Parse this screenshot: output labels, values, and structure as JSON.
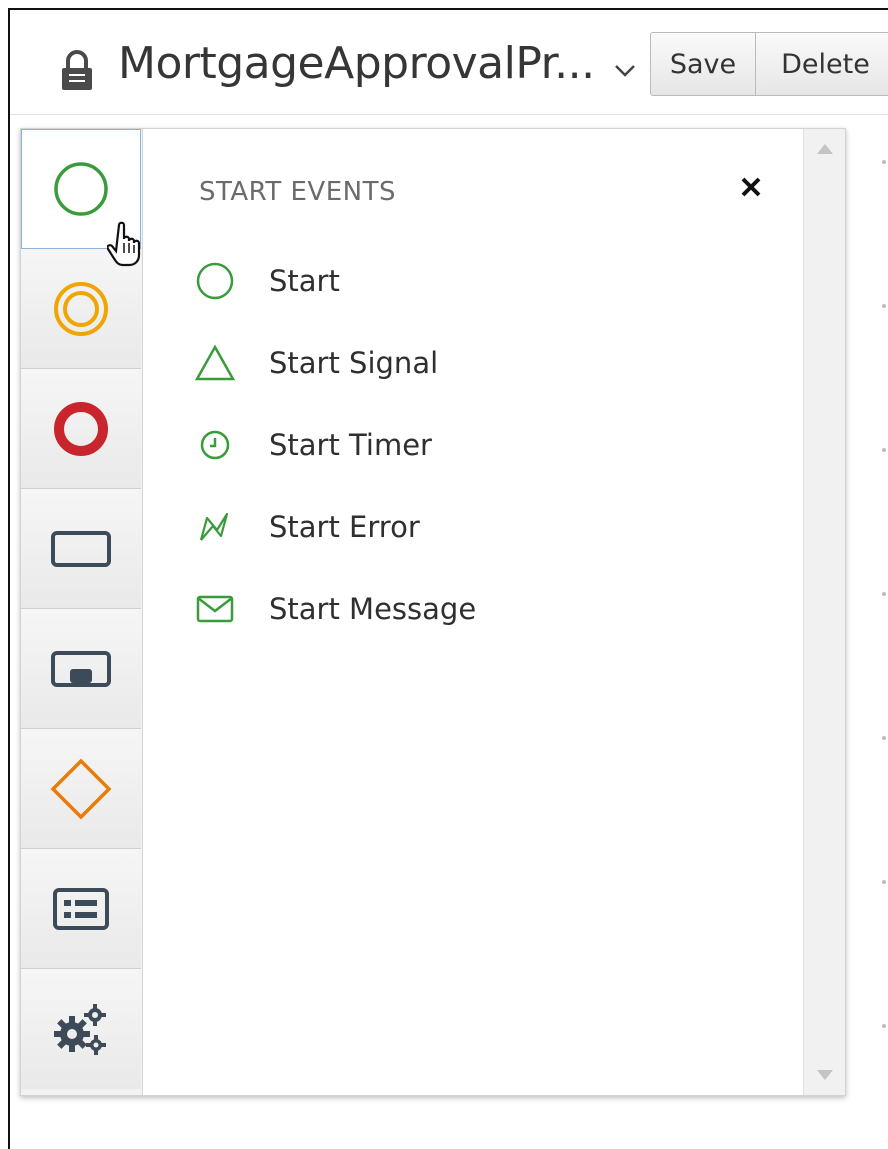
{
  "header": {
    "title": "MortgageApprovalPr...",
    "save_label": "Save",
    "delete_label": "Delete"
  },
  "palette": {
    "tools": [
      {
        "name": "start-events-tool",
        "icon": "circle-icon",
        "color": "#3a9b3a",
        "active": true
      },
      {
        "name": "intermediate-events-tool",
        "icon": "double-circle-icon",
        "color": "#f0a500"
      },
      {
        "name": "end-events-tool",
        "icon": "thick-circle-icon",
        "color": "#c9252c"
      },
      {
        "name": "activities-tool",
        "icon": "rectangle-icon",
        "color": "#3d4a57"
      },
      {
        "name": "subprocesses-tool",
        "icon": "subprocess-icon",
        "color": "#3d4a57"
      },
      {
        "name": "gateways-tool",
        "icon": "diamond-icon",
        "color": "#ec7a08"
      },
      {
        "name": "containers-tool",
        "icon": "lane-icon",
        "color": "#3d4a57"
      },
      {
        "name": "service-tasks-tool",
        "icon": "gears-icon",
        "color": "#3d4a57"
      }
    ],
    "flyout": {
      "title": "START EVENTS",
      "items": [
        {
          "label": "Start",
          "icon": "circle-icon"
        },
        {
          "label": "Start Signal",
          "icon": "triangle-icon"
        },
        {
          "label": "Start Timer",
          "icon": "clock-icon"
        },
        {
          "label": "Start Error",
          "icon": "lightning-icon"
        },
        {
          "label": "Start Message",
          "icon": "envelope-icon"
        }
      ]
    }
  },
  "colors": {
    "event_green": "#3a9b3a",
    "accent_blue": "#8ab4e0"
  }
}
